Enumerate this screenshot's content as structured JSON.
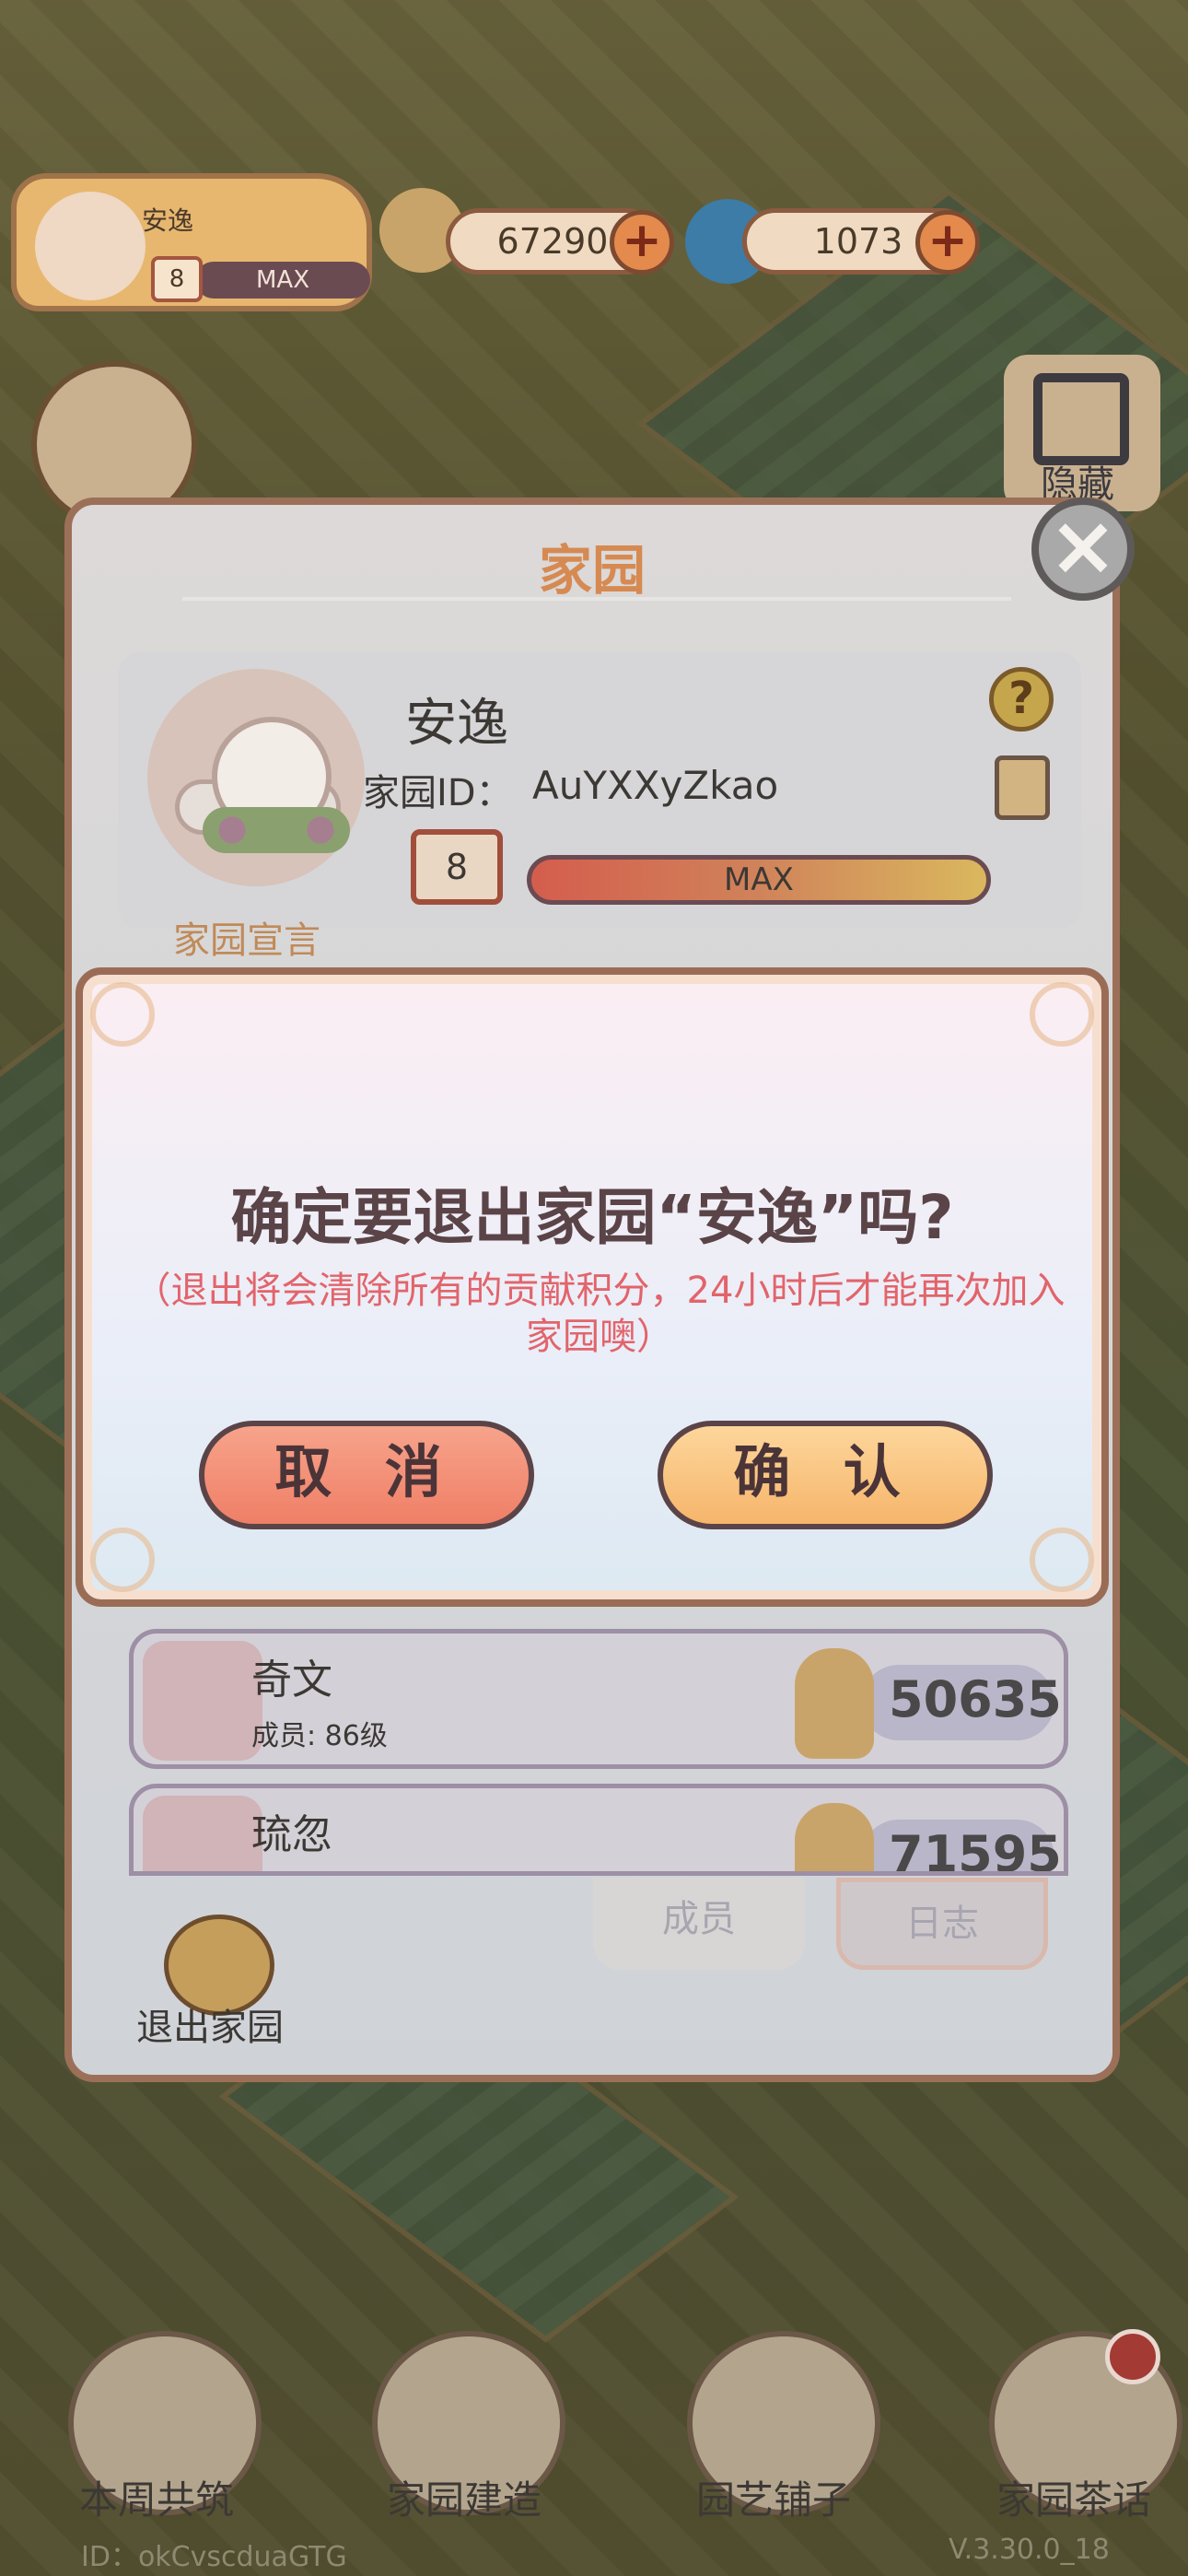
{
  "hud": {
    "player_name": "安逸",
    "house_level": "8",
    "level_bar_text": "MAX",
    "coins": "67290",
    "gems": "1073",
    "hide_label": "隐藏"
  },
  "home_panel": {
    "title": "家园",
    "name": "安逸",
    "id_label": "家园ID：",
    "id_value": "AuYXXyZkao",
    "level": "8",
    "level_bar_text": "MAX",
    "manifesto_label": "家园宣言",
    "members": [
      {
        "name": "奇文",
        "level": "成员: 86级",
        "score": "50635"
      },
      {
        "name": "琉忽",
        "level": "",
        "score": "71595"
      }
    ],
    "tabs": {
      "members": "成员",
      "log": "日志"
    },
    "quit_label": "退出家园"
  },
  "dialog": {
    "question": "确定要退出家园“安逸”吗?",
    "warning": "（退出将会清除所有的贡献积分，24小时后才能再次加入家园噢）",
    "cancel_label": "取 消",
    "confirm_label": "确 认"
  },
  "bottom_nav": {
    "items": [
      {
        "label": "本周共筑"
      },
      {
        "label": "家园建造"
      },
      {
        "label": "园艺铺子"
      },
      {
        "label": "家园茶话"
      }
    ]
  },
  "footer": {
    "user_id": "ID：okCvscduaGTG",
    "version": "V.3.30.0_18"
  },
  "colors": {
    "accent": "#d68a52",
    "warning": "#e2646b",
    "cancel": "#ef7f66",
    "confirm": "#f6b56b"
  }
}
